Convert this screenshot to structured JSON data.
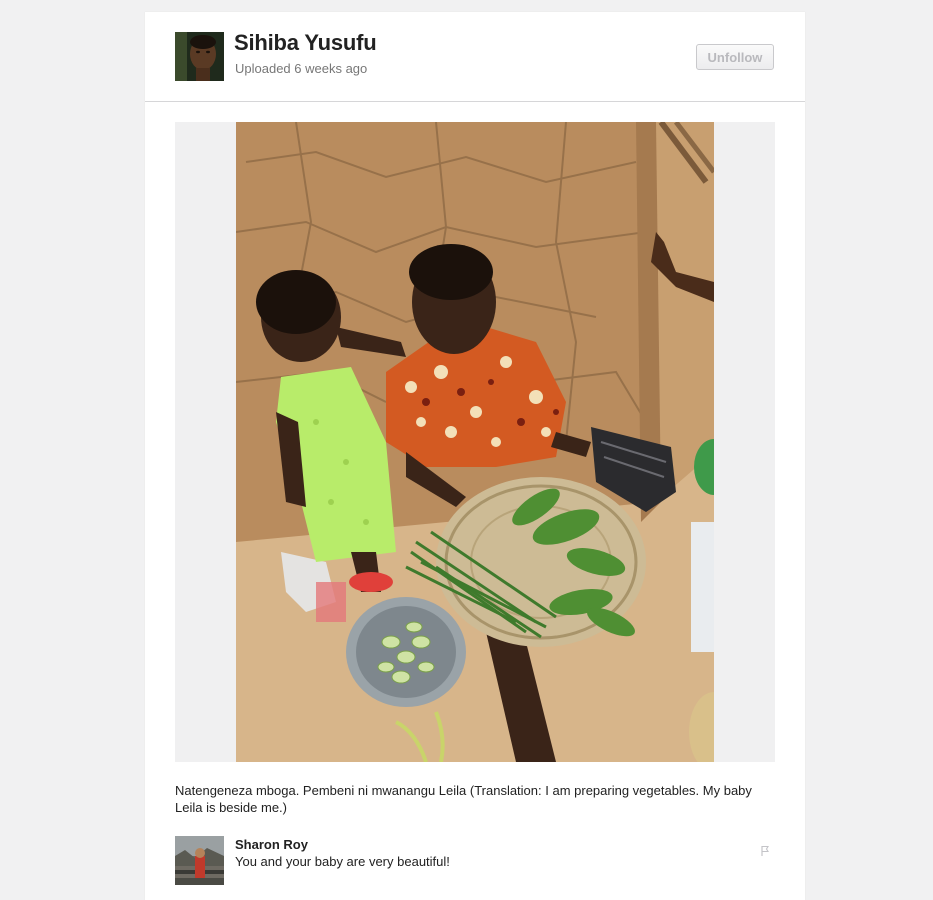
{
  "post": {
    "author_name": "Sihiba Yusufu",
    "upload_time": "Uploaded 6 weeks ago",
    "unfollow_label": "Unfollow",
    "caption": "Natengeneza mboga. Pembeni ni mwanangu Leila (Translation: I am preparing vegetables. My baby Leila is beside me.)"
  },
  "comments": [
    {
      "author": "Sharon Roy",
      "text": "You and your baby are very beautiful!"
    }
  ],
  "colors": {
    "page_background": "#f1f1f2",
    "card_background": "#ffffff",
    "muted_text": "#777777",
    "disabled_button_text": "#b9b9bd"
  },
  "icons": {
    "comment_flag": "flag-icon"
  }
}
